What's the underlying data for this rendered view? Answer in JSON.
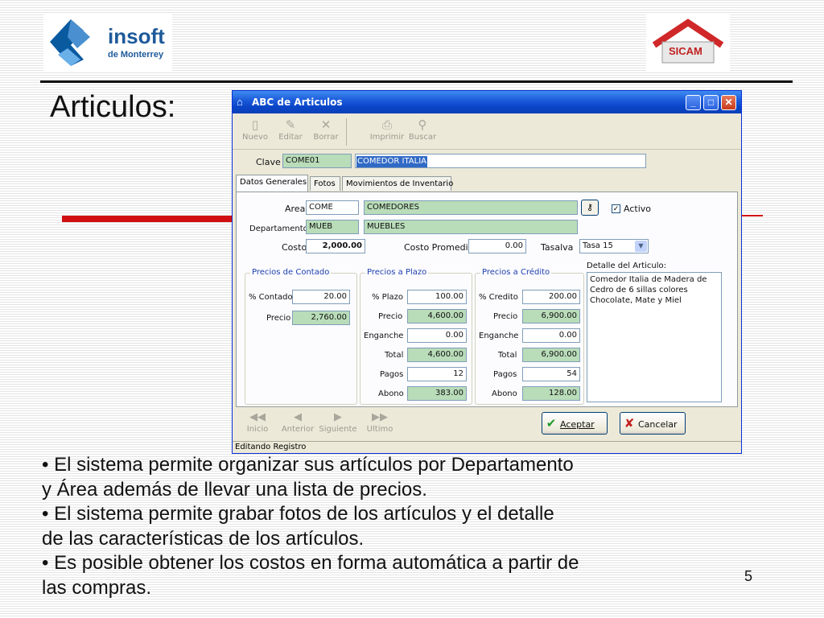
{
  "slide": {
    "title": "Articulos",
    "logo_left": {
      "name": "insoft",
      "sub": "de Monterrey"
    },
    "logo_right": {
      "name": "SICAM"
    },
    "bullets": [
      "• El sistema permite organizar sus artículos por Departamento",
      "y Área además de llevar una lista de precios.",
      "• El sistema permite grabar fotos de los artículos y el detalle",
      "de las características de los artículos.",
      "• Es posible obtener los costos en forma automática a partir de",
      "las compras."
    ],
    "page_number": "5"
  },
  "window": {
    "title": "ABC de Articulos",
    "toolbar": {
      "nuevo": "Nuevo",
      "editar": "Editar",
      "borrar": "Borrar",
      "imprimir": "Imprimir",
      "buscar": "Buscar"
    },
    "clave": {
      "label": "Clave",
      "code": "COME01",
      "description": "COMEDOR ITALIA"
    },
    "tabs": [
      "Datos Generales",
      "Fotos",
      "Movimientos de Inventario"
    ],
    "general": {
      "area_label": "Area",
      "area_code": "COME",
      "area_name": "COMEDORES",
      "activo_label": "Activo",
      "departamento_label": "Departamento",
      "departamento_code": "MUEB",
      "departamento_name": "MUEBLES",
      "costo_label": "Costo",
      "costo": "2,000.00",
      "costo_promedio_label": "Costo Promedio",
      "costo_promedio": "0.00",
      "tasaiva_label": "Tasalva",
      "tasaiva": "Tasa 15"
    },
    "contado": {
      "title": "Precios de Contado",
      "pct_label": "% Contado",
      "pct": "20.00",
      "precio_label": "Precio",
      "precio": "2,760.00"
    },
    "plazo": {
      "title": "Precios a Plazo",
      "pct_label": "% Plazo",
      "pct": "100.00",
      "precio_label": "Precio",
      "precio": "4,600.00",
      "enganche_label": "Enganche",
      "enganche": "0.00",
      "total_label": "Total",
      "total": "4,600.00",
      "pagos_label": "Pagos",
      "pagos": "12",
      "abono_label": "Abono",
      "abono": "383.00"
    },
    "credito": {
      "title": "Precios a Crédito",
      "pct_label": "% Credito",
      "pct": "200.00",
      "precio_label": "Precio",
      "precio": "6,900.00",
      "enganche_label": "Enganche",
      "enganche": "0.00",
      "total_label": "Total",
      "total": "6,900.00",
      "pagos_label": "Pagos",
      "pagos": "54",
      "abono_label": "Abono",
      "abono": "128.00"
    },
    "detalle": {
      "label": "Detalle del Articulo:",
      "text": "Comedor Italia de Madera de Cedro de 6 sillas colores Chocolate, Mate y Miel"
    },
    "nav": {
      "inicio": "Inicio",
      "anterior": "Anterior",
      "siguiente": "Siguiente",
      "ultimo": "Ultimo"
    },
    "buttons": {
      "aceptar": "Aceptar",
      "cancelar": "Cancelar"
    },
    "status": "Editando Registro"
  }
}
